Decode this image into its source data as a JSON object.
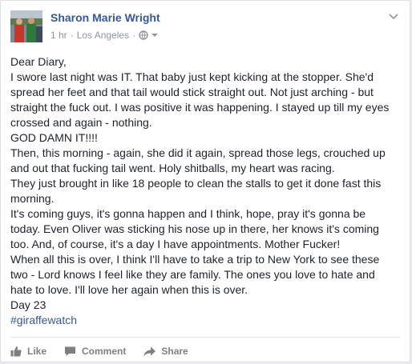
{
  "post": {
    "author": "Sharon Marie Wright",
    "time": "1 hr",
    "separator": "·",
    "location": "Los Angeles",
    "privacy_separator": "·",
    "privacy_icon": "globe-icon",
    "menu_icon": "chevron-down-icon",
    "lines": [
      "Dear Diary,",
      "I swore last night was IT. That baby just kept kicking at the stopper. She'd",
      "spread her feet and that tail would stick straight out. Not just arching - but",
      "straight the fuck out. I was positive it was happening. I stayed up till my eyes",
      "crossed and again - nothing.",
      "GOD DAMN IT!!!!",
      "Then, this morning - again, she did it again, spread those legs, crouched up",
      "and out that fucking tail went. Holy shitballs, my heart was racing.",
      "They just brought in like 18 people to clean the stalls to get it done fast this",
      "morning.",
      "It's coming guys, it's gonna happen and I think, hope, pray it's gonna be",
      "today. Even Oliver was sticking his nose up in there, her knows it's coming",
      "too. And, of course, it's a day I have appointments. Mother Fucker!",
      "When all this is over, I think I'll have to take a trip to New York to see these",
      "two - Lord knows I feel like they are family. The ones you love to hate and",
      "hate to love. I'll love her again when this is over.",
      "Day 23"
    ],
    "hashtag": "#giraffewatch"
  },
  "actions": {
    "like": "Like",
    "comment": "Comment",
    "share": "Share"
  },
  "colors": {
    "link": "#365899",
    "text": "#1d2129",
    "meta": "#90949c",
    "action": "#7f7f7f"
  }
}
